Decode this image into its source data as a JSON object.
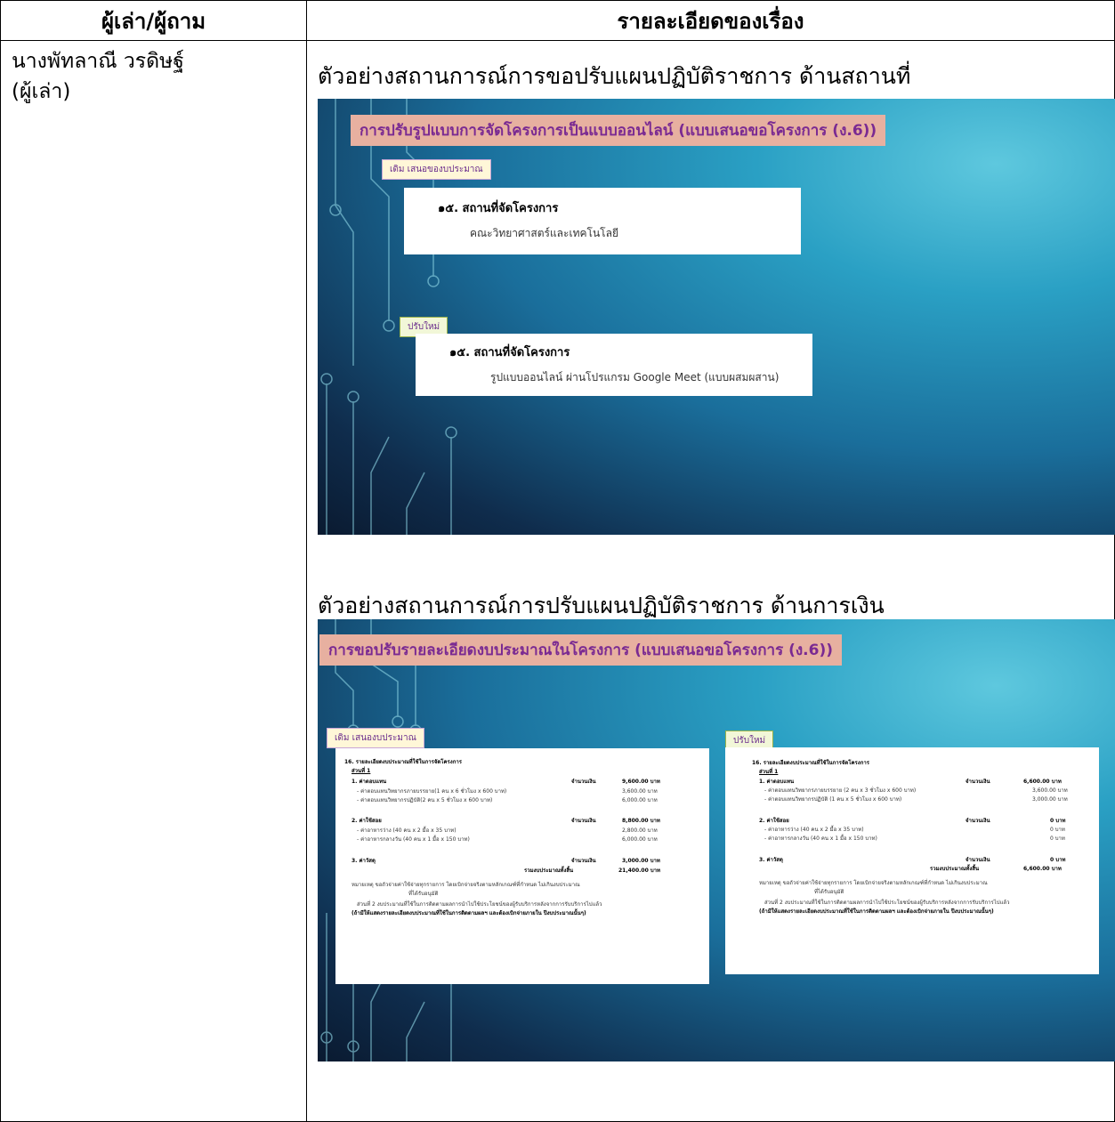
{
  "table": {
    "col1_header": "ผู้เล่า/ผู้ถาม",
    "col2_header": "รายละเอียดของเรื่อง"
  },
  "narrator": {
    "name": "นางพัทลาณี วรดิษฐ์",
    "role": "(ผู้เล่า)"
  },
  "section1": {
    "heading": "ตัวอย่างสถานการณ์การขอปรับแผนปฏิบัติราชการ ด้านสถานที่",
    "slide_title": "การปรับรูปแบบการจัดโครงการเป็นแบบออนไลน์ (แบบเสนอขอโครงการ (ง.6))",
    "old_tag": "เดิม เสนอของบประมาณ",
    "old_label": "๑๕. สถานที่จัดโครงการ",
    "old_value": "คณะวิทยาศาสตร์และเทคโนโลยี",
    "new_tag": "ปรับใหม่",
    "new_label": "๑๕. สถานที่จัดโครงการ",
    "new_value": "รูปแบบออนไลน์ ผ่านโปรแกรม Google Meet (แบบผสมผสาน)"
  },
  "section2": {
    "heading": "ตัวอย่างสถานการณ์การปรับแผนปฏิบัติราชการ ด้านการเงิน",
    "slide_title": "การขอปรับรายละเอียดงบประมาณในโครงการ (แบบเสนอขอโครงการ (ง.6))",
    "old_tag": "เดิม เสนองบประมาณ",
    "new_tag": "ปรับใหม่",
    "old_budget": {
      "title": "16. รายละเอียดงบประมาณที่ใช้ในการจัดโครงการ",
      "part1": "ส่วนที่ 1",
      "i1": "1. ค่าตอบแทน",
      "i1_amt": "จำนวนเงิน",
      "i1_total": "9,600.00  บาท",
      "i1a": "- ค่าตอบแทนวิทยากรภายบรรยาย(1 คน x 6 ชั่วโมง x 600 บาท)",
      "i1a_v": "3,600.00  บาท",
      "i1b": "- ค่าตอบแทนวิทยากรปฏิบัติ(2 คน x 5 ชั่วโมง x 600 บาท)",
      "i1b_v": "6,000.00  บาท",
      "i2": "2. ค่าใช้สอย",
      "i2_amt": "จำนวนเงิน",
      "i2_total": "8,800.00  บาท",
      "i2a": "- ค่าอาหารว่าง (40 คน x 2 มื้อ x 35 บาท)",
      "i2a_v": "2,800.00  บาท",
      "i2b": "- ค่าอาหารกลางวัน (40 คน x 1 มื้อ x 150 บาท)",
      "i2b_v": "6,000.00  บาท",
      "i3": "3. ค่าวัสดุ",
      "i3_amt": "จำนวนเงิน",
      "i3_total": "3,000.00  บาท",
      "sum_lbl": "รวมงบประมาณทั้งสิ้น",
      "sum_v": "21,400.00  บาท",
      "note": "หมายเหตุ ขอถัวจ่ายค่าใช้จ่ายทุกรายการ โดยเบิกจ่ายจริงตามหลักเกณฑ์ที่กำหนด ไม่เกินงบประมาณ",
      "note2": "ที่ได้รับอนุมัติ",
      "part2": "ส่วนที่ 2 งบประมาณที่ใช้ในการติดตามผลการนำไปใช้ประโยชน์ของผู้รับบริการหลังจากการรับบริการไปแล้ว",
      "part2b": "(ถ้ามีให้แสดงรายละเอียดงบประมาณที่ใช้ในการติดตามผลฯ และต้องเบิกจ่ายภายใน ปีงบประมาณนั้นๆ)"
    },
    "new_budget": {
      "title": "16. รายละเอียดงบประมาณที่ใช้ในการจัดโครงการ",
      "part1": "ส่วนที่ 1",
      "i1": "1. ค่าตอบแทน",
      "i1_amt": "จำนวนเงิน",
      "i1_total": "6,600.00  บาท",
      "i1a": "- ค่าตอบแทนวิทยากรภายบรรยาย (2 คน x  3 ชั่วโมง x 600 บาท)",
      "i1a_v": "3,600.00  บาท",
      "i1b": "- ค่าตอบแทนวิทยากรปฏิบัติ (1 คน x 5 ชั่วโมง x 600 บาท)",
      "i1b_v": "3,000.00  บาท",
      "i2": "2. ค่าใช้สอย",
      "i2_amt": "จำนวนเงิน",
      "i2_total": "0  บาท",
      "i2a": "- ค่าอาหารว่าง (40 คน x 2 มื้อ x 35 บาท)",
      "i2a_v": "0  บาท",
      "i2b": "- ค่าอาหารกลางวัน (40 คน x 1 มื้อ x 150 บาท)",
      "i2b_v": "0  บาท",
      "i3": "3. ค่าวัสดุ",
      "i3_amt": "จำนวนเงิน",
      "i3_total": "0  บาท",
      "sum_lbl": "รวมงบประมาณทั้งสิ้น",
      "sum_v": "6,600.00  บาท",
      "note": "หมายเหตุ ขอถัวจ่ายค่าใช้จ่ายทุกรายการ โดยเบิกจ่ายจริงตามหลักเกณฑ์ที่กำหนด ไม่เกินงบประมาณ",
      "note2": "ที่ได้รับอนุมัติ",
      "part2": "ส่วนที่ 2 งบประมาณที่ใช้ในการติดตามผลการนำไปใช้ประโยชน์ของผู้รับบริการหลังจากการรับบริการไปแล้ว",
      "part2b": "(ถ้ามีให้แสดงรายละเอียดงบประมาณที่ใช้ในการติดตามผลฯ และต้องเบิกจ่ายภายใน ปีงบประมาณนั้นๆ)"
    }
  }
}
